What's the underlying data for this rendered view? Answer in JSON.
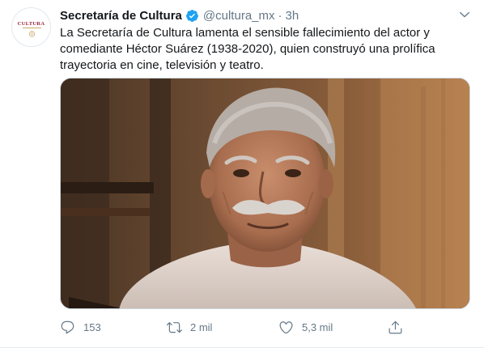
{
  "account": {
    "avatar_text": "CULTURA",
    "name": "Secretaría de Cultura",
    "handle": "@cultura_mx",
    "separator": "·",
    "time": "3h",
    "verified": true
  },
  "tweet": {
    "text_lines": [
      "La Secretaría de Cultura lamenta el sensible fallecimiento del actor y",
      "comediante Héctor Suárez (1938-2020), quien construyó una prolífica",
      "trayectoria en cine, televisión y teatro."
    ]
  },
  "actions": {
    "reply_count": "153",
    "retweet_count": "2 mil",
    "like_count": "5,3 mil"
  },
  "colors": {
    "text": "#14171a",
    "secondary": "#657786",
    "verified": "#1da1f2",
    "brand": "#9b2242"
  }
}
